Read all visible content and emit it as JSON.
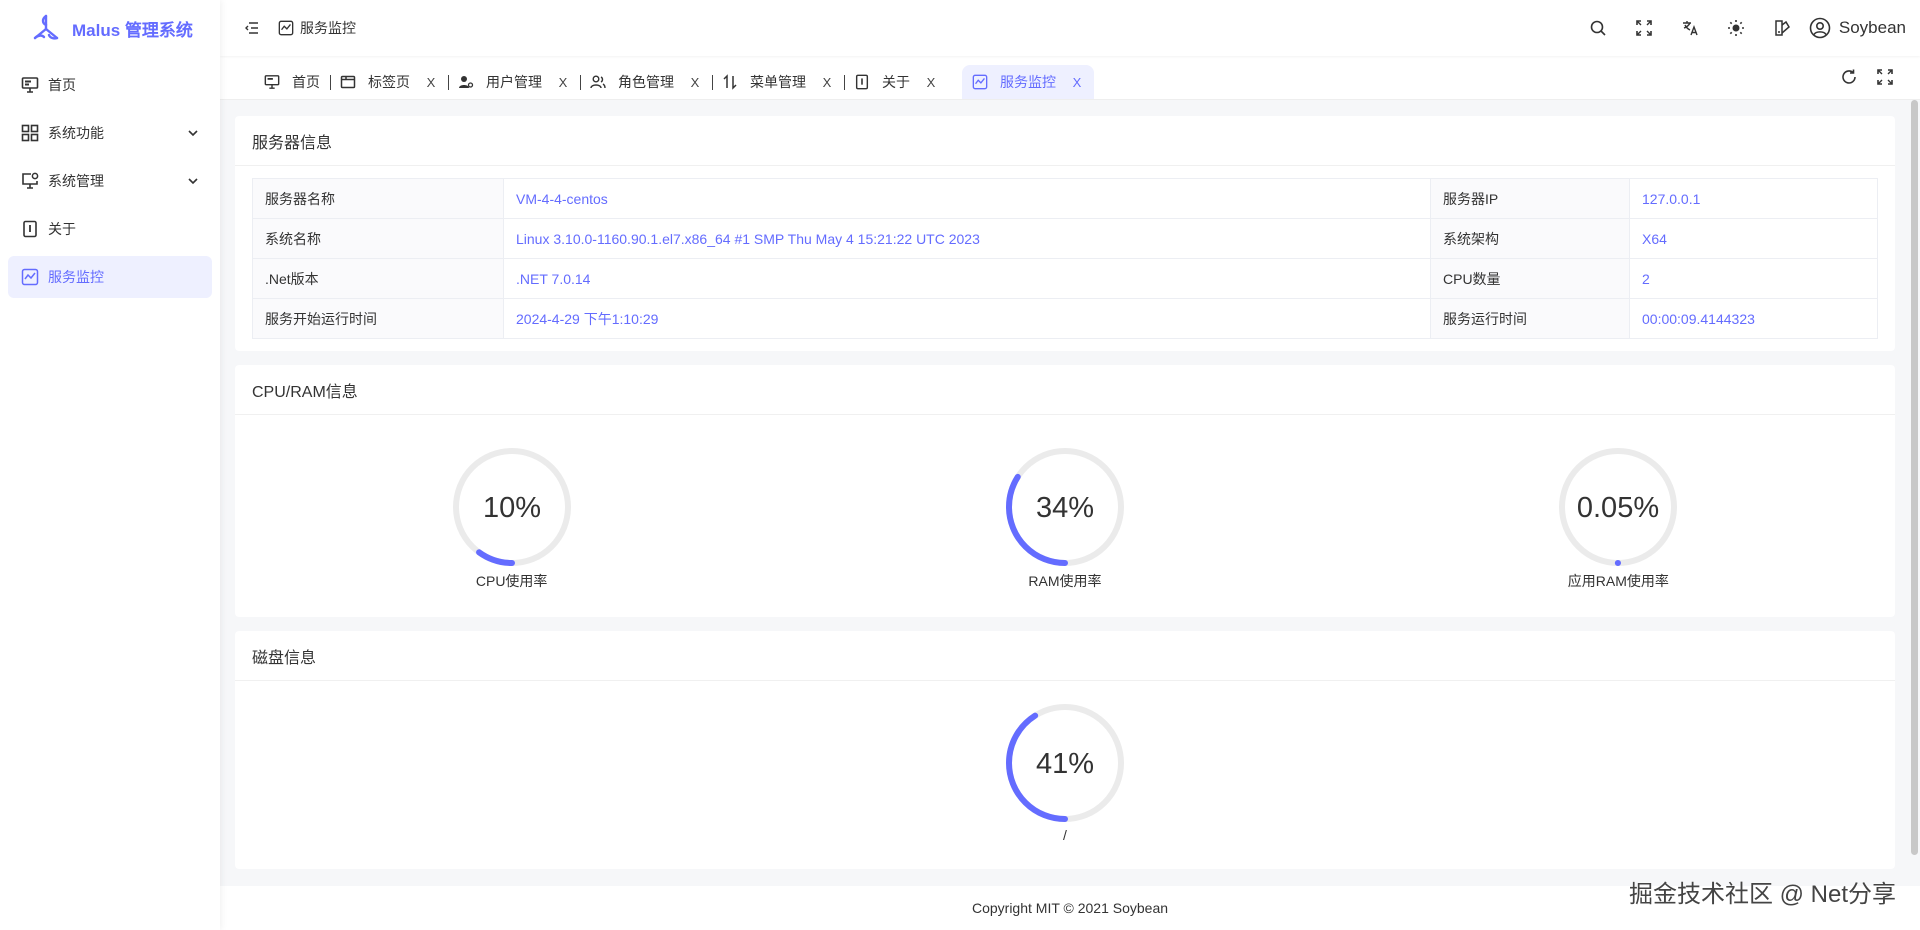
{
  "brand": {
    "title": "Malus 管理系统",
    "accent": "#646cff"
  },
  "sidebar": {
    "items": [
      {
        "label": "首页",
        "icon": "monitor-icon",
        "active": false,
        "expandable": false
      },
      {
        "label": "系统功能",
        "icon": "grid-icon",
        "active": false,
        "expandable": true
      },
      {
        "label": "系统管理",
        "icon": "monitor-gear-icon",
        "active": false,
        "expandable": true
      },
      {
        "label": "关于",
        "icon": "info-icon",
        "active": false,
        "expandable": false
      },
      {
        "label": "服务监控",
        "icon": "chart-icon",
        "active": true,
        "expandable": false
      }
    ]
  },
  "header": {
    "breadcrumb": "服务监控",
    "user_name": "Soybean",
    "tools": [
      "search-icon",
      "fullscreen-icon",
      "translate-icon",
      "theme-icon",
      "theme-config-icon"
    ]
  },
  "tabs": [
    {
      "label": "首页",
      "icon": "monitor-icon",
      "closable": false,
      "active": false
    },
    {
      "label": "标签页",
      "icon": "window-icon",
      "closable": true,
      "active": false
    },
    {
      "label": "用户管理",
      "icon": "user-gear-icon",
      "closable": true,
      "active": false
    },
    {
      "label": "角色管理",
      "icon": "users-icon",
      "closable": true,
      "active": false
    },
    {
      "label": "菜单管理",
      "icon": "sort-icon",
      "closable": true,
      "active": false
    },
    {
      "label": "关于",
      "icon": "info-icon",
      "closable": true,
      "active": false
    },
    {
      "label": "服务监控",
      "icon": "chart-icon",
      "closable": true,
      "active": true
    }
  ],
  "tab_close_glyph": "X",
  "server_card": {
    "title": "服务器信息",
    "rows": [
      {
        "l1": "服务器名称",
        "v1": "VM-4-4-centos",
        "l2": "服务器IP",
        "v2": "127.0.0.1"
      },
      {
        "l1": "系统名称",
        "v1": "Linux 3.10.0-1160.90.1.el7.x86_64 #1 SMP Thu May 4 15:21:22 UTC 2023",
        "l2": "系统架构",
        "v2": "X64"
      },
      {
        "l1": ".Net版本",
        "v1": ".NET 7.0.14",
        "l2": "CPU数量",
        "v2": "2"
      },
      {
        "l1": "服务开始运行时间",
        "v1": "2024-4-29 下午1:10:29",
        "l2": "服务运行时间",
        "v2": "00:00:09.4144323"
      }
    ]
  },
  "cpu_card": {
    "title": "CPU/RAM信息",
    "gauges": [
      {
        "label": "CPU使用率",
        "percent": 10,
        "text": "10%"
      },
      {
        "label": "RAM使用率",
        "percent": 34,
        "text": "34%"
      },
      {
        "label": "应用RAM使用率",
        "percent": 0.05,
        "text": "0.05%"
      }
    ]
  },
  "disk_card": {
    "title": "磁盘信息",
    "gauges": [
      {
        "label": "/",
        "percent": 41,
        "text": "41%"
      }
    ]
  },
  "footer": {
    "copyright": "Copyright MIT © 2021 Soybean"
  },
  "watermark": "掘金技术社区 @ Net分享",
  "colors": {
    "accent": "#646cff",
    "track": "#ebebeb",
    "active_bg": "#eef0ff"
  }
}
